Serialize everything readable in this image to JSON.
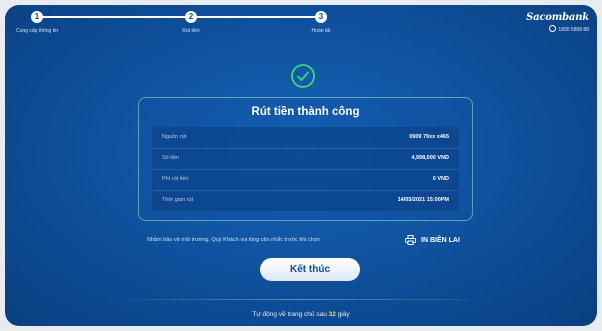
{
  "stepper": {
    "steps": [
      {
        "number": "1",
        "label": "Cung cấp thông tin"
      },
      {
        "number": "2",
        "label": "Rút tiền"
      },
      {
        "number": "3",
        "label": "Hoàn tất"
      }
    ]
  },
  "brand": {
    "name": "Sacombank",
    "phone": "1800 5858 88"
  },
  "card": {
    "title": "Rút tiền thành công",
    "rows": [
      {
        "label": "Nguồn rút",
        "value": "0909 79xx x465"
      },
      {
        "label": "Số tiền",
        "value": "4,998,000 VND"
      },
      {
        "label": "Phí rút tiền",
        "value": "0 VND"
      },
      {
        "label": "Thời gian rút",
        "value": "14/05/2021 15:00PM"
      }
    ]
  },
  "note": "Nhằm bảo vệ môi trường, Quý Khách vui lòng cân nhắc trước khi chọn",
  "print_label": "IN BIÊN LAI",
  "finish_label": "Kết thúc",
  "footer": {
    "prefix": "Tự động về trang chủ sau",
    "count": "32",
    "suffix": "giây"
  },
  "colors": {
    "background": "#0e4f9a",
    "accent_success": "#38d87a",
    "countdown": "#ffd84d"
  },
  "icons": {
    "success": "check-circle-icon",
    "print": "printer-icon",
    "phone": "phone-icon"
  }
}
